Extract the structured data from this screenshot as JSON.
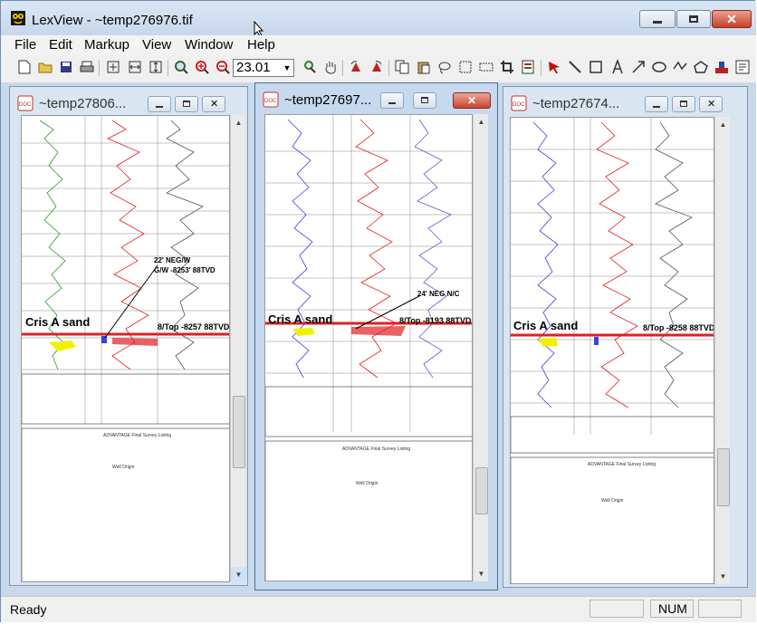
{
  "app": {
    "title": "LexView - ~temp276976.tif"
  },
  "menu": [
    "File",
    "Edit",
    "Markup",
    "View",
    "Window",
    "Help"
  ],
  "toolbar": {
    "zoom_value": "23.01"
  },
  "windows": [
    {
      "title": "~temp27806...",
      "sand_label": "Cris A sand",
      "top_label": "8/Top -8257 88TVD",
      "annotation_line1": "22' NEG/W",
      "annotation_line2": "G/W -8253' 88TVD",
      "report_title": "ADVANTAGE Final Survey Listing",
      "section_label": "Well Origin"
    },
    {
      "title": "~temp27697...",
      "sand_label": "Cris A sand",
      "top_label": "8/Top -8193 88TVD",
      "annotation_line1": "24' NEG N/C",
      "report_title": "ADVANTAGE Final Survey Listing",
      "section_label": "Well Origin"
    },
    {
      "title": "~temp27674...",
      "sand_label": "Cris A sand",
      "top_label": "8/Top -8258 88TVD",
      "report_title": "ADVANTAGE Final Survey Listing",
      "section_label": "Well Origin"
    }
  ],
  "status": {
    "text": "Ready",
    "num": "NUM"
  },
  "colors": {
    "accent": "#c8402c",
    "log_red": "#e02020",
    "log_green": "#2a9a2a",
    "log_blue": "#4040e0",
    "sand_yellow": "#f0f000"
  }
}
